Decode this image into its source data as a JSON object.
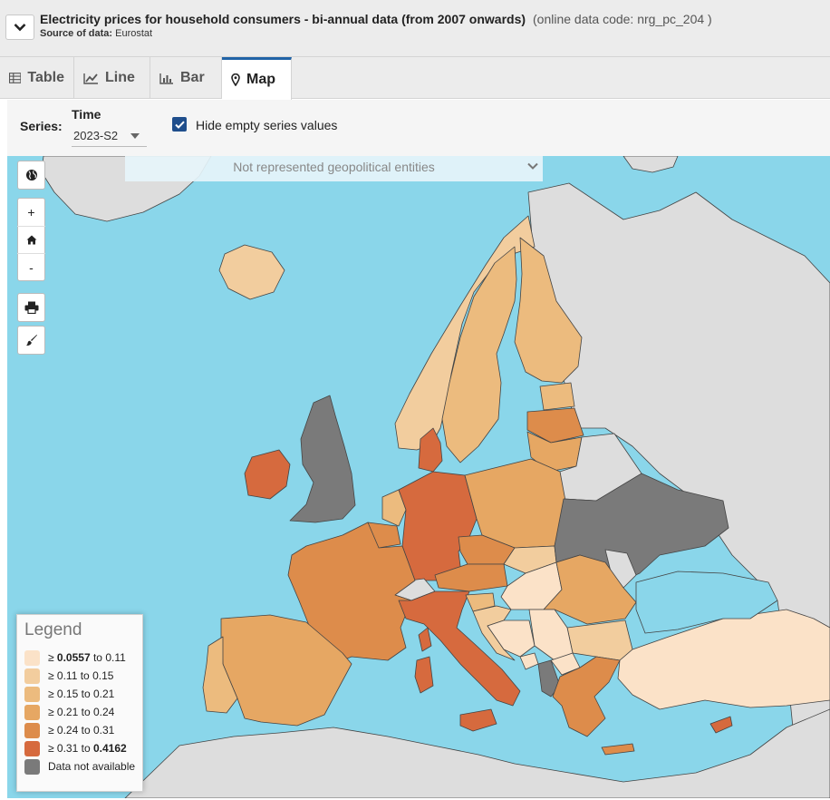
{
  "header": {
    "title": "Electricity prices for household consumers - bi-annual data (from 2007 onwards)",
    "code_text": "(online data code: nrg_pc_204 )",
    "source_label": "Source of data:",
    "source_value": "Eurostat"
  },
  "tabs": [
    {
      "label": "Table",
      "icon": "table-icon"
    },
    {
      "label": "Line",
      "icon": "line-chart-icon"
    },
    {
      "label": "Bar",
      "icon": "bar-chart-icon"
    },
    {
      "label": "Map",
      "icon": "map-marker-icon",
      "active": true
    }
  ],
  "series": {
    "label": "Series:",
    "time_label": "Time",
    "time_value": "2023-S2",
    "hide_empty_label": "Hide empty series values",
    "hide_empty_checked": true
  },
  "map": {
    "not_represented_label": "Not represented geopolitical entities",
    "controls": [
      "globe-icon",
      "zoom-in",
      "home-icon",
      "zoom-out",
      "print-icon",
      "brush-icon"
    ],
    "zoom_in_label": "+",
    "zoom_out_label": "-",
    "colors": {
      "sea": "#8ad6ea",
      "no_data_land": "#dddddd",
      "not_available": "#7a7a7a",
      "class1": "#fbe2c8",
      "class2": "#f2cd9e",
      "class3": "#ecbb7e",
      "class4": "#e6a763",
      "class5": "#dd8c4b",
      "class6": "#d66a3e"
    }
  },
  "legend": {
    "title": "Legend",
    "items": [
      {
        "prefix": "≥ ",
        "low": "0.0557",
        "mid": " to ",
        "high": "0.11",
        "low_bold": true,
        "high_bold": false,
        "color": "#fbe2c8"
      },
      {
        "prefix": "≥ ",
        "low": "0.11",
        "mid": " to ",
        "high": "0.15",
        "low_bold": false,
        "high_bold": false,
        "color": "#f2cd9e"
      },
      {
        "prefix": "≥ ",
        "low": "0.15",
        "mid": " to ",
        "high": "0.21",
        "low_bold": false,
        "high_bold": false,
        "color": "#ecbb7e"
      },
      {
        "prefix": "≥ ",
        "low": "0.21",
        "mid": " to ",
        "high": "0.24",
        "low_bold": false,
        "high_bold": false,
        "color": "#e6a763"
      },
      {
        "prefix": "≥ ",
        "low": "0.24",
        "mid": " to ",
        "high": "0.31",
        "low_bold": false,
        "high_bold": false,
        "color": "#dd8c4b"
      },
      {
        "prefix": "≥ ",
        "low": "0.31",
        "mid": " to ",
        "high": "0.4162",
        "low_bold": false,
        "high_bold": true,
        "color": "#d66a3e"
      }
    ],
    "na_label": "Data not available",
    "na_color": "#7a7a7a"
  }
}
